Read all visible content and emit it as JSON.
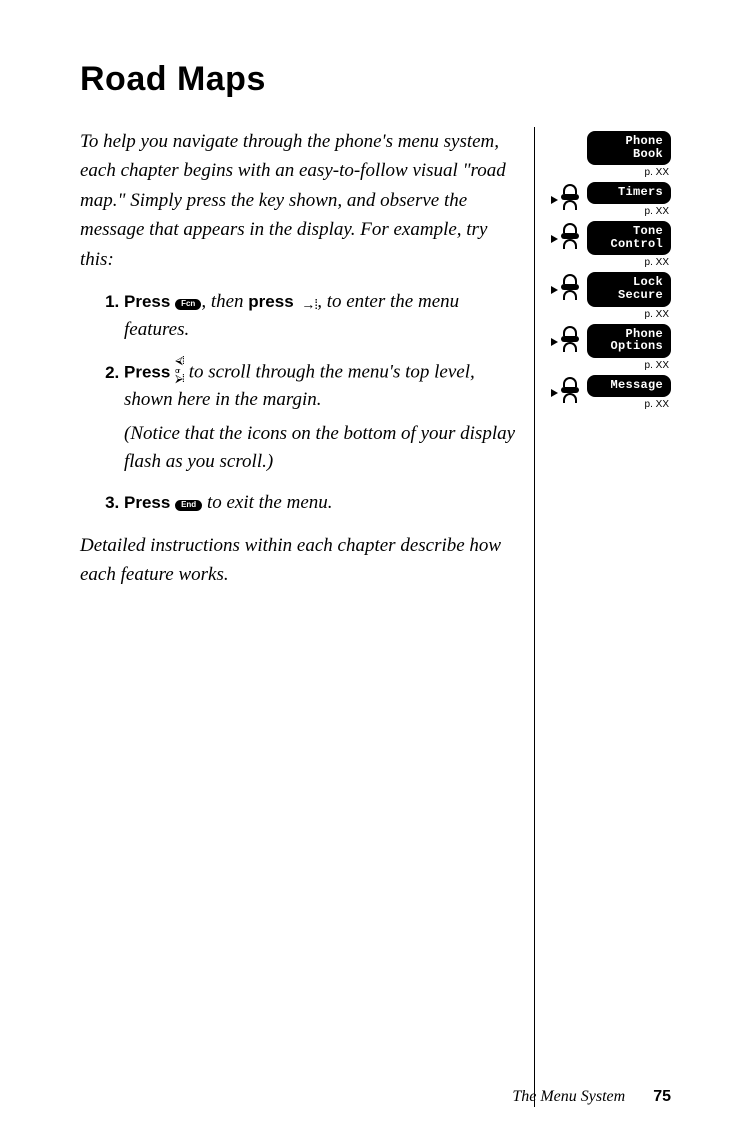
{
  "heading": "Road Maps",
  "intro": "To help you navigate through the phone's menu system, each chapter begins with an easy-to-follow visual \"road map.\" Simply press the key shown, and observe the message that appears in the display. For example, try this:",
  "steps": {
    "s1": {
      "press": "Press",
      "key_fcn": "Fcn",
      "mid": ", then ",
      "press2": "press",
      "tail": ", to enter the menu features."
    },
    "s2": {
      "press": "Press",
      "tail": " to scroll through the menu's top level, shown here in the margin.",
      "note": "(Notice that the icons on the bottom of your display flash as you scroll.)"
    },
    "s3": {
      "press": "Press",
      "key_end": "End",
      "tail": " to exit the menu."
    }
  },
  "outro": "Detailed instructions within each chapter describe how each feature works.",
  "sidebar": {
    "items": [
      {
        "label": "Phone\nBook",
        "page": "p. XX",
        "scroll": false
      },
      {
        "label": "Timers",
        "page": "p. XX",
        "scroll": true
      },
      {
        "label": "Tone\nControl",
        "page": "p. XX",
        "scroll": true
      },
      {
        "label": "Lock\nSecure",
        "page": "p. XX",
        "scroll": true
      },
      {
        "label": "Phone\nOptions",
        "page": "p. XX",
        "scroll": true
      },
      {
        "label": "Message",
        "page": "p. XX",
        "scroll": true
      }
    ]
  },
  "footer": {
    "section": "The Menu System",
    "page": "75"
  }
}
